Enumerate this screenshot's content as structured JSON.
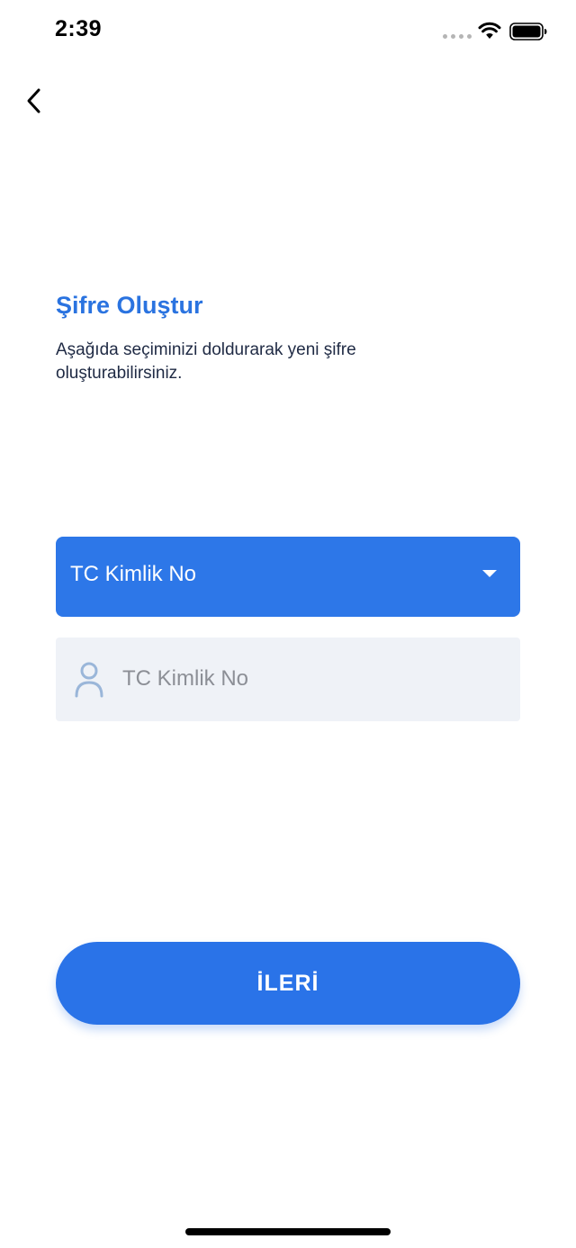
{
  "status_bar": {
    "time": "2:39",
    "icons": [
      "cellular-dots-icon",
      "wifi-icon",
      "battery-icon"
    ]
  },
  "nav": {
    "back_icon": "chevron-left-icon"
  },
  "header": {
    "title": "Şifre Oluştur",
    "subtitle": "Aşağıda seçiminizi doldurarak yeni şifre oluşturabilirsiniz."
  },
  "form": {
    "id_type_select": {
      "selected": "TC Kimlik No",
      "icon": "chevron-down-icon"
    },
    "id_number_field": {
      "value": "",
      "placeholder": "TC Kimlik No",
      "icon": "user-icon"
    }
  },
  "actions": {
    "next_label": "İLERİ"
  },
  "colors": {
    "primary": "#2a73e8",
    "title": "#2a73e0",
    "field_background": "#eff2f7",
    "text": "#1f2a44",
    "placeholder": "#8c8f96",
    "icon_muted": "#9ab6d9"
  }
}
